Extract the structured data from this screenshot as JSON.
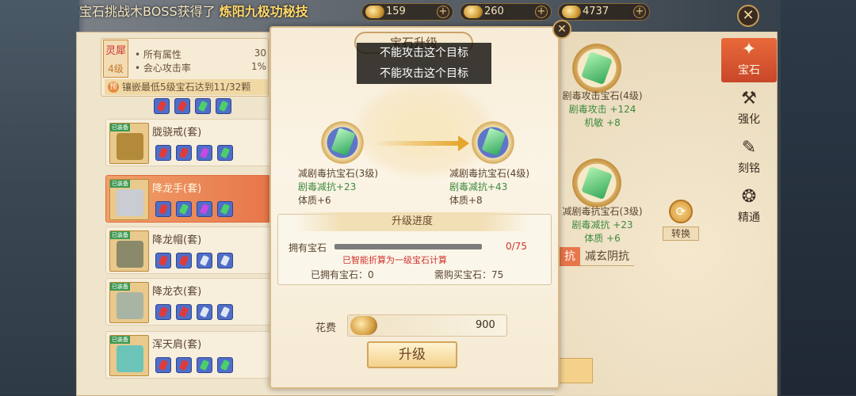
{
  "ticker": {
    "prefix": "宝石",
    "text": "挑战木BOSS获得了",
    "highlight": "炼阳九极功秘技"
  },
  "resources": [
    {
      "value": "159",
      "icon": "jade-coin-icon"
    },
    {
      "value": "260",
      "icon": "gold-ingot-icon"
    },
    {
      "value": "4737",
      "icon": "silver-ingot-icon"
    }
  ],
  "attr_panel": {
    "badge_title": "灵犀",
    "badge_level": "4级",
    "rows": [
      {
        "label": "• 所有属性",
        "value": "30"
      },
      {
        "label": "• 会心攻击率",
        "value": "1%"
      }
    ],
    "note_badge": "预",
    "note": "镶嵌最低5级宝石达到11/32颗"
  },
  "equipment": [
    {
      "name": "胧骁戒(套)",
      "tag": "已装备",
      "gems": [
        "red",
        "red",
        "purple",
        "green"
      ]
    },
    {
      "name": "降龙手(套)",
      "tag": "已装备",
      "gems": [
        "red",
        "green",
        "purple",
        "green"
      ],
      "selected": true
    },
    {
      "name": "降龙帽(套)",
      "tag": "已装备",
      "gems": [
        "red",
        "red",
        "white",
        "white"
      ]
    },
    {
      "name": "降龙衣(套)",
      "tag": "已装备",
      "gems": [
        "red",
        "red",
        "white",
        "white"
      ]
    },
    {
      "name": "浑天肩(套)",
      "tag": "已装备",
      "gems": [
        "red",
        "red",
        "green",
        "green"
      ]
    }
  ],
  "right_gems": [
    {
      "name": "剧毒攻击宝石(4级)",
      "stat1": "剧毒攻击 +124",
      "stat2": "机敏 +8"
    },
    {
      "name": "减剧毒抗宝石(3级)",
      "stat1": "剧毒减抗 +23",
      "stat2": "体质 +6"
    }
  ],
  "side_nav": [
    {
      "label": "宝石",
      "icon": "gem-nav-icon",
      "active": true
    },
    {
      "label": "强化",
      "icon": "anvil-nav-icon"
    },
    {
      "label": "刻铭",
      "icon": "engrave-nav-icon"
    },
    {
      "label": "精通",
      "icon": "mastery-nav-icon"
    }
  ],
  "convert_label": "转换",
  "resist_tabs": [
    "抗",
    "减玄阴抗"
  ],
  "modal": {
    "title": "宝石升级",
    "toasts": [
      "不能攻击这个目标",
      "不能攻击这个目标"
    ],
    "from": {
      "name": "减剧毒抗宝石(3级)",
      "stat1": "剧毒减抗+23",
      "stat2": "体质+6"
    },
    "to": {
      "name": "减剧毒抗宝石(4级)",
      "stat1": "剧毒减抗+43",
      "stat2": "体质+8"
    },
    "progress_title": "升级进度",
    "owned_label": "拥有宝石",
    "progress_value": "0/75",
    "progress_fraction": 0,
    "smart_note": "已智能折算为一级宝石计算",
    "owned_text": "已拥有宝石：0",
    "need_text": "需购买宝石：75",
    "cost_label": "花费",
    "cost_value": "900",
    "upgrade_label": "升级"
  },
  "colors": {
    "accent": "#e7764a",
    "progress": "#e5a62c",
    "stat_green": "#3e8a3e",
    "warn_red": "#d0342e"
  }
}
